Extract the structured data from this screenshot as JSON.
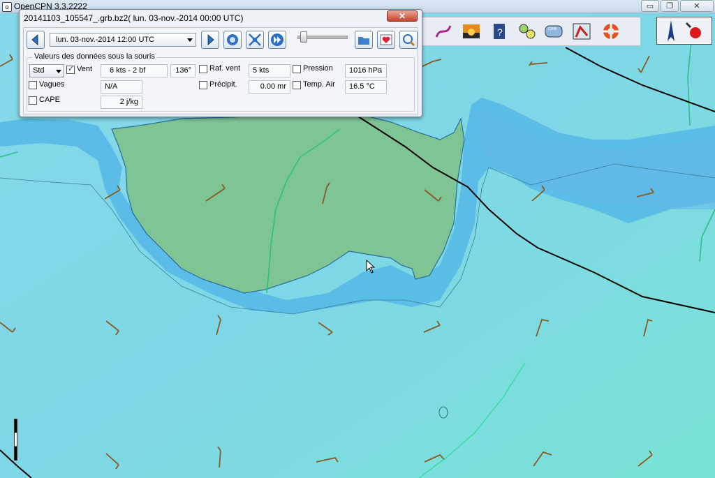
{
  "app": {
    "title": "OpenCPN 3.3.2222"
  },
  "window_controls": {
    "minimize": "▭",
    "restore": "❐",
    "close": "✕"
  },
  "grib": {
    "title": "20141103_105547_.grb.bz2( lun. 03-nov.-2014 00:00  UTC)",
    "close_label": "✕",
    "date_value": "lun. 03-nov.-2014 12:00  UTC",
    "group_label": "Valeurs des données sous la souris",
    "std_value": "Std",
    "vent": {
      "label": "Vent",
      "speed": "6 kts -  2 bf",
      "dir": "136°",
      "checked": true
    },
    "raf": {
      "label": "Raf. vent",
      "value": "5 kts",
      "checked": false
    },
    "pression": {
      "label": "Pression",
      "value": "1016 hPa",
      "checked": false
    },
    "vagues": {
      "label": "Vagues",
      "value": "N/A",
      "checked": false
    },
    "precip": {
      "label": "Précipit.",
      "value": "0.00 mr",
      "checked": false
    },
    "temp": {
      "label": "Temp. Air",
      "value": "16.5 °C",
      "checked": false
    },
    "cape": {
      "label": "CAPE",
      "value": "2 j/kg",
      "checked": false
    }
  },
  "colors": {
    "sea": "#7fd8e8",
    "shallow": "#4db6e8",
    "land": "#7fc495",
    "track": "#000000",
    "barb": "#8a5a20"
  }
}
